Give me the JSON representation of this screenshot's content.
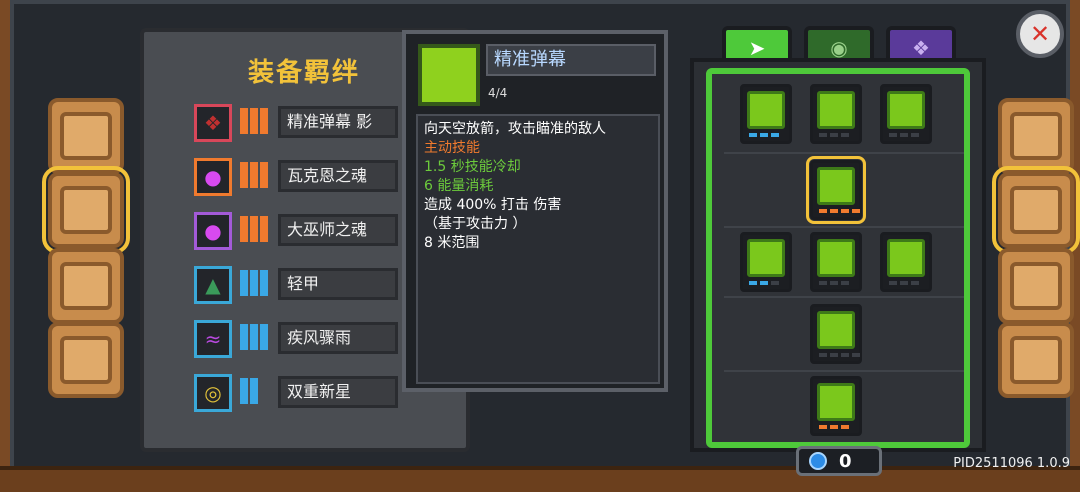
{
  "panel_title": "装备羁绊",
  "bonds": [
    {
      "name": "精准弹幕 影",
      "icon": "dark-flame-icon",
      "border_color": "#d8475a",
      "bar_color": "#f07a2e"
    },
    {
      "name": "瓦克恩之魂",
      "icon": "purple-flame-icon",
      "border_color": "#f07a2e",
      "bar_color": "#f07a2e"
    },
    {
      "name": "大巫师之魂",
      "icon": "purple-flame-icon",
      "border_color": "#a35ad8",
      "bar_color": "#f07a2e"
    },
    {
      "name": "轻甲",
      "icon": "armor-icon",
      "border_color": "#3aa8d8",
      "bar_color": "#3aa8e6"
    },
    {
      "name": "疾风骤雨",
      "icon": "tornado-icon",
      "border_color": "#3aa8d8",
      "bar_color": "#3aa8e6"
    },
    {
      "name": "双重新星",
      "icon": "nova-icon",
      "border_color": "#3aa8d8",
      "bar_color": "#3aa8e6"
    }
  ],
  "tooltip": {
    "title": "精准弹幕",
    "level": "4/4",
    "lines": [
      {
        "text": "向天空放箭，攻击瞄准的敌人",
        "color": "#ffffff"
      },
      {
        "text": "主动技能",
        "color": "#f07a2e"
      },
      {
        "text": "1.5 秒技能冷却",
        "color": "#6ccb3c"
      },
      {
        "text": "6 能量消耗",
        "color": "#6ccb3c"
      },
      {
        "text": "造成 400% 打击 伤害",
        "color": "#ffffff"
      },
      {
        "text": "（基于攻击力 ）",
        "color": "#ffffff"
      },
      {
        "text": "8 米范围",
        "color": "#ffffff"
      }
    ]
  },
  "tabs": [
    "bow-icon",
    "leaf-icon",
    "rune-icon"
  ],
  "currency": {
    "value": "0"
  },
  "pid": "PID2511096 1.0.9",
  "colors": {
    "accent": "#f2c23a",
    "tree_border": "#4ec93a"
  }
}
